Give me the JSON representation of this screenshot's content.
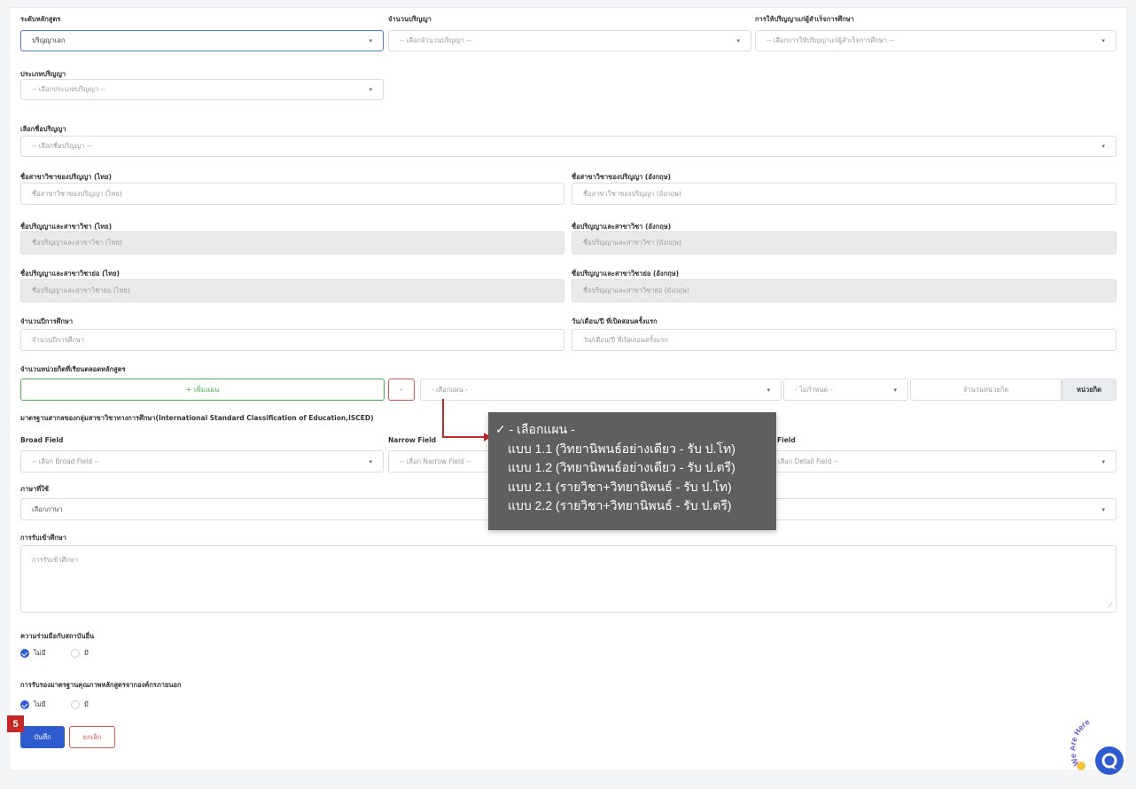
{
  "fields": {
    "course_level": {
      "label": "ระดับหลักสูตร",
      "value": "ปริญญาเอก"
    },
    "degree_count": {
      "label": "จำนวนปริญญา",
      "placeholder": "-- เลือกจำนวนปริญญา --"
    },
    "degree_award": {
      "label": "การให้ปริญญาแก่ผู้สำเร็จการศึกษา",
      "placeholder": "-- เลือกการให้ปริญญาแก่ผู้สำเร็จการศึกษา --"
    },
    "degree_type": {
      "label": "ประเภทปริญญา",
      "placeholder": "-- เลือกประเภทปริญญา --"
    },
    "degree_name": {
      "label": "เลือกชื่อปริญญา",
      "placeholder": "-- เลือกชื่อปริญญา --"
    },
    "major_th": {
      "label": "ชื่อสาขาวิชาของปริญญา (ไทย)",
      "placeholder": "ชื่อสาขาวิชาของปริญญา (ไทย)"
    },
    "major_en": {
      "label": "ชื่อสาขาวิชาของปริญญา (อังกฤษ)",
      "placeholder": "ชื่อสาขาวิชาของปริญญา (อังกฤษ)"
    },
    "degree_major_th": {
      "label": "ชื่อปริญญาและสาขาวิชา (ไทย)",
      "placeholder": "ชื่อปริญญาและสาขาวิชา (ไทย)"
    },
    "degree_major_en": {
      "label": "ชื่อปริญญาและสาขาวิชา (อังกฤษ)",
      "placeholder": "ชื่อปริญญาและสาขาวิชา (อังกฤษ)"
    },
    "degree_abbr_th": {
      "label": "ชื่อปริญญาและสาขาวิชาย่อ (ไทย)",
      "placeholder": "ชื่อปริญญาและสาขาวิชาย่อ (ไทย)"
    },
    "degree_abbr_en": {
      "label": "ชื่อปริญญาและสาขาวิชาย่อ (อังกฤษ)",
      "placeholder": "ชื่อปริญญาและสาขาวิชาย่อ (อังกฤษ)"
    },
    "study_years": {
      "label": "จำนวนปีการศึกษา",
      "placeholder": "จำนวนปีการศึกษา"
    },
    "start_date": {
      "label": "วัน/เดือน/ปี ที่เปิดสอนครั้งแรก",
      "placeholder": "วัน/เดือน/ปี ที่เปิดสอนครั้งแรก"
    },
    "credits": {
      "label": "จำนวนหน่วยกิตที่เรียนตลอดหลักสูตร",
      "add_plan": "+ เพิ่มแผน",
      "remove": "-",
      "plan_placeholder": "- เลือกแผน -",
      "spec_placeholder": "- ไม่กำหนด -",
      "credit_placeholder": "จำนวนหน่วยกิต",
      "unit": "หน่วยกิต"
    },
    "isced": {
      "label": "มาตรฐานสากลของกลุ่มสาขาวิชาทางการศึกษา(International Standard Classification of Education,ISCED)",
      "broad_label": "Broad Field",
      "broad_placeholder": "-- เลือก Broad Field --",
      "narrow_label": "Narrow Field",
      "narrow_placeholder": "-- เลือก Narrow Field --",
      "detail_label": "Field",
      "detail_placeholder": "เลือก Detail Field --"
    },
    "language": {
      "label": "ภาษาที่ใช้",
      "value": "เลือกภาษา"
    },
    "admission": {
      "label": "การรับเข้าศึกษา",
      "placeholder": "การรับเข้าศึกษา"
    },
    "cooperation": {
      "label": "ความร่วมมือกับสถาบันอื่น",
      "opt_no": "ไม่มี",
      "opt_yes": "มี"
    },
    "certification": {
      "label": "การรับรองมาตรฐานคุณภาพหลักสูตรจากองค์กรภายนอก",
      "opt_no": "ไม่มี",
      "opt_yes": "มี"
    }
  },
  "plan_dropdown": {
    "options": [
      "✓ - เลือกแผน -",
      "แบบ 1.1 (วิทยานิพนธ์อย่างเดียว - รับ ป.โท)",
      "แบบ 1.2 (วิทยานิพนธ์อย่างเดียว - รับ ป.ตรี)",
      "แบบ 2.1 (รายวิชา+วิทยานิพนธ์ - รับ ป.โท)",
      "แบบ 2.2 (รายวิชา+วิทยานิพนธ์ - รับ ป.ตรี)"
    ]
  },
  "actions": {
    "step_badge": "5",
    "save": "บันทึก",
    "cancel": "ยกเลิก"
  },
  "chat_widget": {
    "text": "We Are Here"
  },
  "colors": {
    "primary": "#2f5bd1",
    "success": "#4caf50",
    "danger": "#d9534f",
    "annotation": "#c62828",
    "dropdown_bg": "#5f5f5f"
  }
}
